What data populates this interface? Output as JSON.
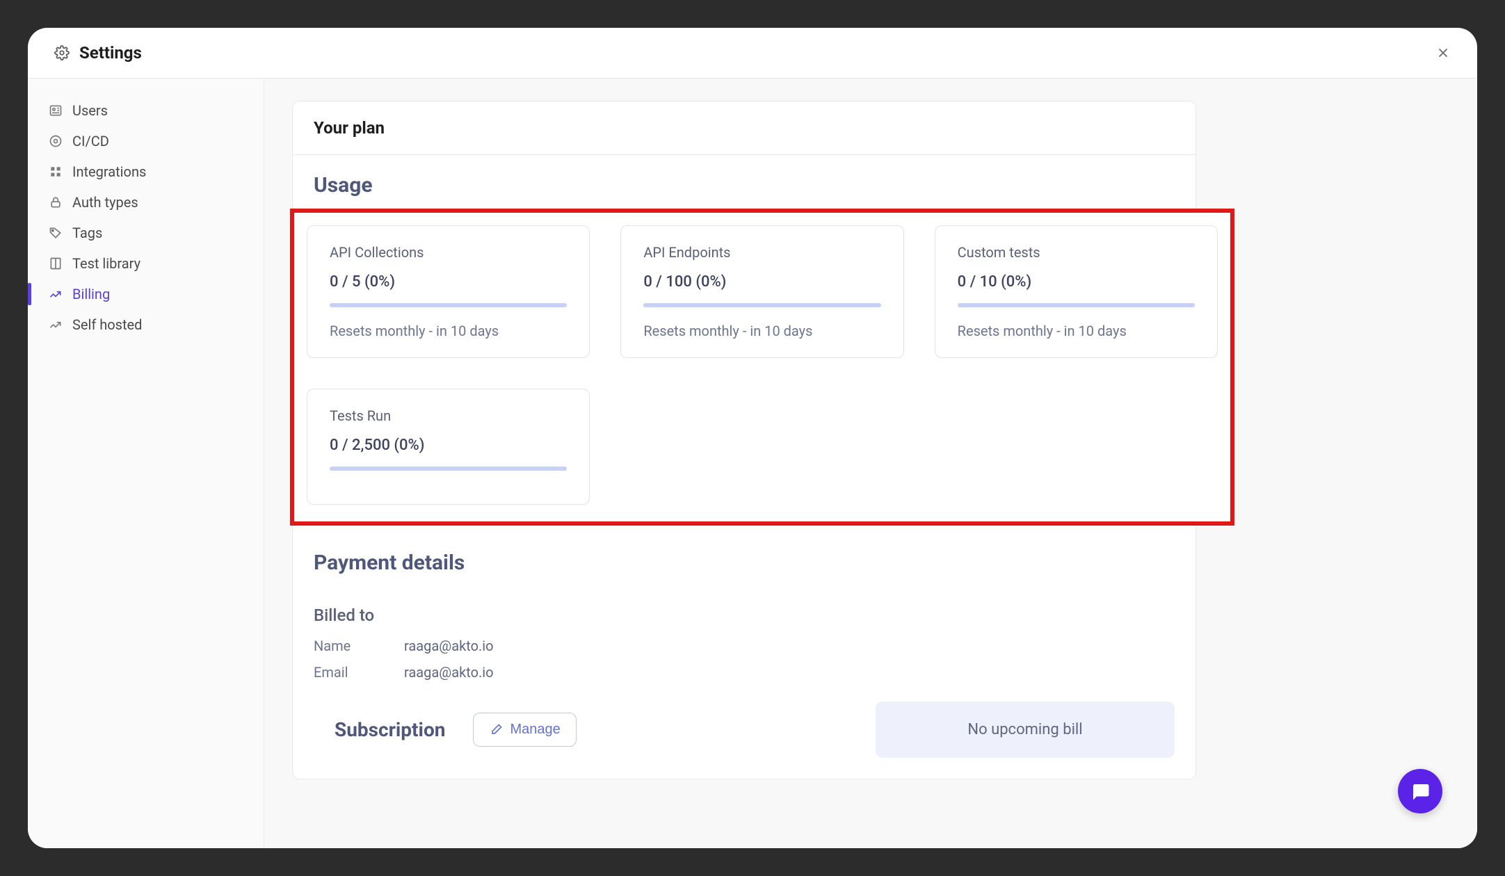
{
  "header": {
    "title": "Settings"
  },
  "sidebar": {
    "items": [
      {
        "label": "Users"
      },
      {
        "label": "CI/CD"
      },
      {
        "label": "Integrations"
      },
      {
        "label": "Auth types"
      },
      {
        "label": "Tags"
      },
      {
        "label": "Test library"
      },
      {
        "label": "Billing"
      },
      {
        "label": "Self hosted"
      }
    ],
    "activeIndex": 6
  },
  "plan": {
    "cardTitle": "Your plan",
    "usageTitle": "Usage",
    "cards": [
      {
        "label": "API Collections",
        "value": "0 / 5 (0%)",
        "reset": "Resets monthly - in 10 days"
      },
      {
        "label": "API Endpoints",
        "value": "0 / 100 (0%)",
        "reset": "Resets monthly - in 10 days"
      },
      {
        "label": "Custom tests",
        "value": "0 / 10 (0%)",
        "reset": "Resets monthly - in 10 days"
      },
      {
        "label": "Tests Run",
        "value": "0 / 2,500 (0%)",
        "reset": ""
      }
    ],
    "payment": {
      "title": "Payment details",
      "billedTo": "Billed to",
      "nameLabel": "Name",
      "nameValue": "raaga@akto.io",
      "emailLabel": "Email",
      "emailValue": "raaga@akto.io"
    },
    "subscription": {
      "title": "Subscription",
      "manage": "Manage",
      "noBill": "No upcoming bill"
    }
  }
}
